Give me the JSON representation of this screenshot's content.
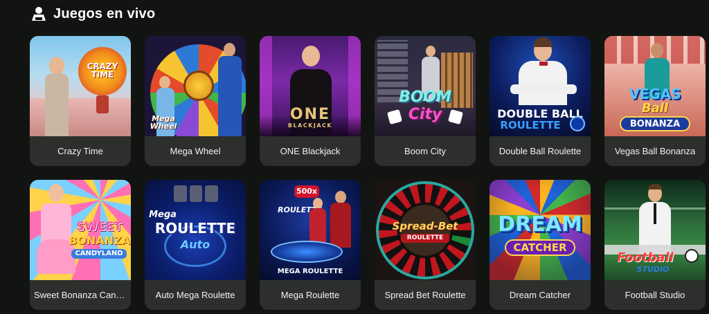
{
  "section": {
    "title": "Juegos en vivo",
    "icon": "live-dealer-icon"
  },
  "games": [
    {
      "name": "Crazy Time",
      "logo": "CRAZY TIME"
    },
    {
      "name": "Mega Wheel",
      "logo": "Mega Wheel"
    },
    {
      "name": "ONE Blackjack",
      "logo": "ONE",
      "logo_sub": "BLACKJACK"
    },
    {
      "name": "Boom City",
      "logo": "BOOM",
      "logo_sub": "City"
    },
    {
      "name": "Double Ball Roulette",
      "logo": "DOUBLE BALL",
      "logo_sub": "ROULETTE"
    },
    {
      "name": "Vegas Ball Bonanza",
      "logo": "VEGAS",
      "logo_mid": "Ball",
      "logo_sub": "BONANZA"
    },
    {
      "name": "Sweet Bonanza Cand...",
      "logo": "SWEET",
      "logo_mid": "BONANZA",
      "logo_sub": "CANDYLAND"
    },
    {
      "name": "Auto Mega Roulette",
      "logo": "Mega",
      "logo_mid": "ROULETTE",
      "logo_sub": "Auto"
    },
    {
      "name": "Mega Roulette",
      "logo": "ROULETTE",
      "logo_sub": "MEGA ROULETTE",
      "badge": "500x"
    },
    {
      "name": "Spread Bet Roulette",
      "logo": "Spread-Bet",
      "logo_sub": "ROULETTE"
    },
    {
      "name": "Dream Catcher",
      "logo": "DREAM",
      "logo_sub": "CATCHER"
    },
    {
      "name": "Football Studio",
      "logo": "Football",
      "logo_sub": "STUDIO"
    }
  ],
  "colors": {
    "background": "#121411",
    "label_bg": "#2d2f2c",
    "text": "#ffffff"
  }
}
